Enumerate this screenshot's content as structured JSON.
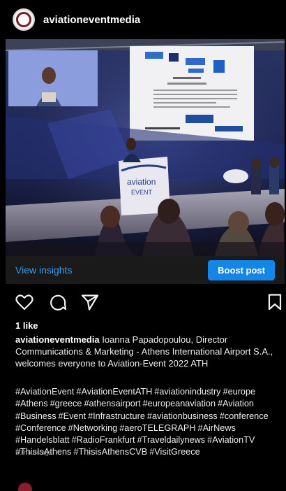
{
  "post": {
    "username": "aviationeventmedia",
    "likes": "1 like",
    "caption_user": "aviationeventmedia",
    "caption_text": "Ioanna Papadopoulou, Director Communications & Marketing - Athens International Airport S.A., welcomes everyone to Aviation-Event 2022 ATH",
    "hashtags": "#AviationEvent #AviationEventATH #aviationindustry #europe #Athens #greece #athensairport #europeanaviation #Aviation #Business #Event #Infrastructure #aviationbusiness #conference #Conference #Networking #aeroTELEGRAPH #AirNews #Handelsblatt #RadioFrankfurt #Traveldailynews #AviationTV #ThisIsAthens #ThisisAthensCVB #VisitGreece",
    "timestamp": "10 hours ago"
  },
  "insights": {
    "view_label": "View insights",
    "boost_label": "Boost post"
  },
  "photo": {
    "podium_line1": "aviation",
    "podium_line2": "EVENT"
  },
  "icons": {
    "like": "heart-icon",
    "comment": "comment-icon",
    "share": "send-icon",
    "save": "bookmark-icon"
  },
  "colors": {
    "background": "#000000",
    "link": "#3b9bf0",
    "button": "#1486e8",
    "brand": "#7a1f2b"
  }
}
